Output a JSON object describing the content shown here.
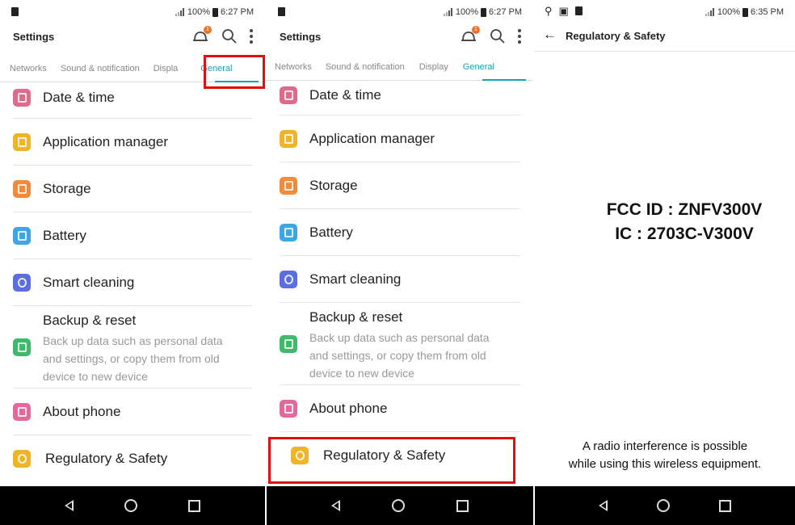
{
  "status_left": {
    "time": "6:27 PM",
    "battery": "100%"
  },
  "status_right": {
    "time": "6:35 PM",
    "battery": "100%"
  },
  "settings": {
    "title": "Settings",
    "tabs": [
      "Networks",
      "Sound & notification",
      "Display",
      "General"
    ],
    "tab_p1_display": "Displa",
    "active_tab": "General",
    "items": [
      {
        "label": "Date & time",
        "color": "#e06a8c",
        "icon": "calendar-icon"
      },
      {
        "label": "Application manager",
        "color": "#f0b429",
        "icon": "apps-icon"
      },
      {
        "label": "Storage",
        "color": "#f08a3c",
        "icon": "storage-icon"
      },
      {
        "label": "Battery",
        "color": "#3fa6e6",
        "icon": "battery-icon"
      },
      {
        "label": "Smart cleaning",
        "color": "#5b6ee0",
        "icon": "smart-cleaning-icon"
      },
      {
        "label": "Backup & reset",
        "desc": "Back up data such as personal data and settings, or copy them from old device to new device",
        "color": "#3dba6a",
        "icon": "backup-icon"
      },
      {
        "label": "About phone",
        "color": "#e06a9c",
        "icon": "phone-info-icon"
      },
      {
        "label": "Regulatory & Safety",
        "color": "#f0b429",
        "icon": "regulatory-icon"
      }
    ]
  },
  "regulatory": {
    "title": "Regulatory & Safety",
    "fcc_id": "FCC ID : ZNFV300V",
    "ic": "IC : 2703C-V300V",
    "notice_line1": "A radio interference is possible",
    "notice_line2": "while using this wireless equipment."
  },
  "colors": {
    "accent": "#1a9fb5",
    "highlight": "#e01010"
  }
}
